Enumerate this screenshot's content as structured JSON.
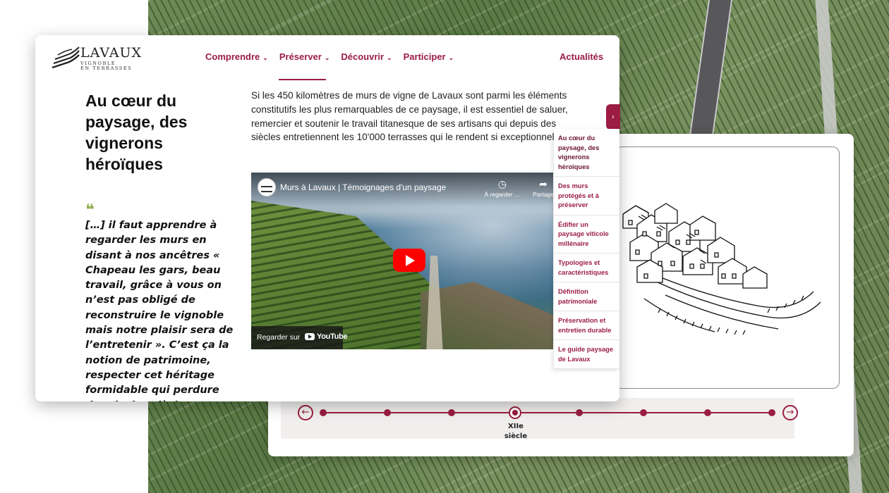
{
  "site": {
    "logo_word": "LAVAUX",
    "logo_sub_1": "VIGNOBLE",
    "logo_sub_2": "EN TERRASSES"
  },
  "nav": {
    "items": [
      {
        "label": "Comprendre"
      },
      {
        "label": "Préserver"
      },
      {
        "label": "Découvrir"
      },
      {
        "label": "Participer"
      }
    ],
    "active": "Préserver",
    "news": "Actualités"
  },
  "main": {
    "heading": "Au cœur du paysage, des vignerons héroïques",
    "intro": "Si les 450 kilomètres de murs de vigne de Lavaux sont parmi les éléments constitutifs les plus remarquables de ce paysage, il est essentiel de saluer, remercier et soutenir le travail titanesque de ses artisans qui depuis des siècles entretiennent les 10'000 terrasses qui le rendent si exceptionnel.",
    "quote_mark": "❝",
    "quote": "[…] il faut apprendre à regarder les murs en disant à nos ancêtres « Chapeau les gars, beau travail, grâce à vous on n’est pas obligé de reconstruire le vignoble mais notre plaisir sera de l’entretenir ». C’est ça la notion de patrimoine, respecter cet héritage formidable qui perdure depuis des siècles… »."
  },
  "video": {
    "title": "Murs à Lavaux | Témoignages d'un paysage",
    "watch_later": "À regarder …",
    "share": "Partage",
    "watch_on": "Regarder sur",
    "youtube": "YouTube"
  },
  "toc": {
    "items": [
      {
        "label": "Au cœur du paysage, des vignerons héroïques"
      },
      {
        "label": "Des murs protégés et à préserver"
      },
      {
        "label": "Édifier un paysage viticole millénaire"
      },
      {
        "label": "Typologies et caractéristiques"
      },
      {
        "label": "Définition patrimoniale"
      },
      {
        "label": "Préservation et entretien durable"
      },
      {
        "label": "Le guide paysage de Lavaux"
      }
    ]
  },
  "timeline": {
    "active_label_1": "XIIe",
    "active_label_2": "siècle",
    "prev_icon": "←",
    "next_icon": "→"
  },
  "colors": {
    "accent": "#9b1d43",
    "quote_mark": "#8cad4a"
  }
}
